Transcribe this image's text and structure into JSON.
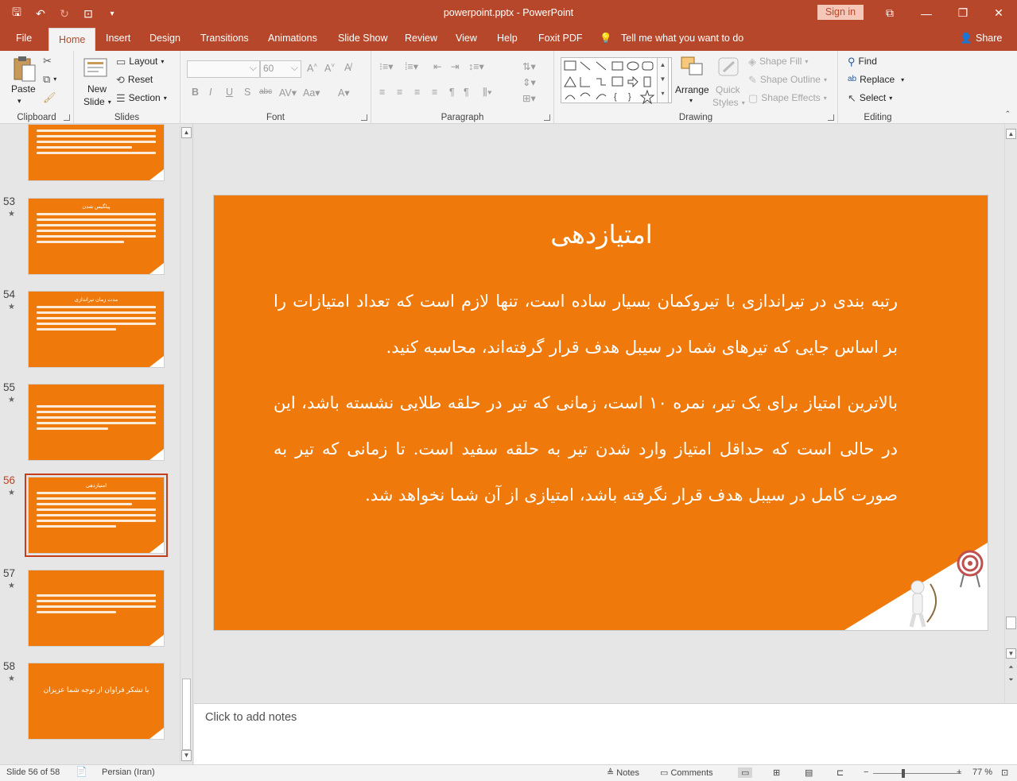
{
  "window": {
    "title": "powerpoint.pptx - PowerPoint",
    "sign_in": "Sign in"
  },
  "tabs": [
    "File",
    "Home",
    "Insert",
    "Design",
    "Transitions",
    "Animations",
    "Slide Show",
    "Review",
    "View",
    "Help",
    "Foxit PDF"
  ],
  "tell_me": "Tell me what you want to do",
  "share": "Share",
  "ribbon": {
    "clipboard": {
      "label": "Clipboard",
      "paste": "Paste"
    },
    "slides": {
      "label": "Slides",
      "new_slide_1": "New",
      "new_slide_2": "Slide",
      "layout": "Layout",
      "reset": "Reset",
      "section": "Section"
    },
    "font": {
      "label": "Font",
      "size": "60"
    },
    "paragraph": {
      "label": "Paragraph"
    },
    "drawing": {
      "label": "Drawing",
      "arrange": "Arrange",
      "quick_styles_1": "Quick",
      "quick_styles_2": "Styles",
      "shape_fill": "Shape Fill",
      "shape_outline": "Shape Outline",
      "shape_effects": "Shape Effects"
    },
    "editing": {
      "label": "Editing",
      "find": "Find",
      "replace": "Replace",
      "select": "Select"
    }
  },
  "thumbnails": [
    {
      "num": "53",
      "title": "پیلگیس شدن"
    },
    {
      "num": "54",
      "title": "مدت زمان تیراندازی"
    },
    {
      "num": "55",
      "title": ""
    },
    {
      "num": "56",
      "title": "امتیازدهی"
    },
    {
      "num": "57",
      "title": ""
    },
    {
      "num": "58",
      "title": "با تشکر فراوان از توجه شما عزیزان"
    }
  ],
  "slide": {
    "title": "امتیازدهی",
    "para1": "رتبه بندی در تیراندازی با تیروکمان بسیار ساده است، تنها لازم است که تعداد امتیازات را بر اساس جایی که تیرهای شما در سیبل هدف قرار گرفته‌اند، محاسبه کنید.",
    "para2": "بالاترین امتیاز برای یک تیر، نمره ۱۰ است، زمانی که تیر در حلقه طلایی نشسته باشد، این در حالی است که حداقل امتیاز وارد شدن تیر به حلقه سفید است. تا زمانی که تیر به صورت کامل در سیبل هدف قرار نگرفته باشد، امتیازی از آن شما نخواهد شد."
  },
  "notes_placeholder": "Click to add notes",
  "status": {
    "slide": "Slide 56 of 58",
    "language": "Persian (Iran)",
    "notes": "Notes",
    "comments": "Comments",
    "zoom": "77 %"
  }
}
